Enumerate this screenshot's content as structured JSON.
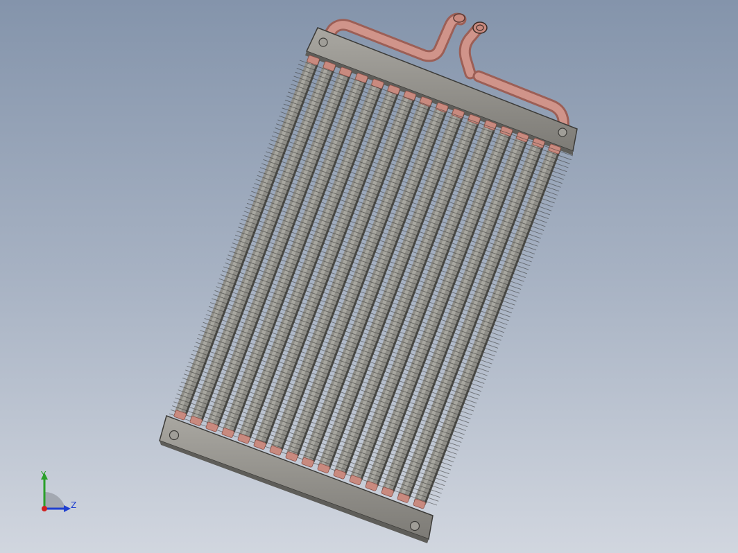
{
  "viewport": {
    "background_top": "#8494ab",
    "background_bottom": "#d1d6df"
  },
  "model": {
    "name": "heat-exchanger-coil",
    "colors": {
      "plate": "#8f8d87",
      "plate_edge": "#3c3b38",
      "tube_copper": "#c98a7f",
      "tube_copper_dark": "#9c5f56",
      "fin_dark": "#3a3a3a",
      "fin_light": "#8a8a84",
      "hole": "#a09e98"
    },
    "tube_count": 16,
    "fin_count": 90
  },
  "triad": {
    "y_label": "Y",
    "z_label": "Z",
    "y_color": "#2aa02a",
    "z_color": "#1f3fd0",
    "x_color": "#d02020"
  }
}
